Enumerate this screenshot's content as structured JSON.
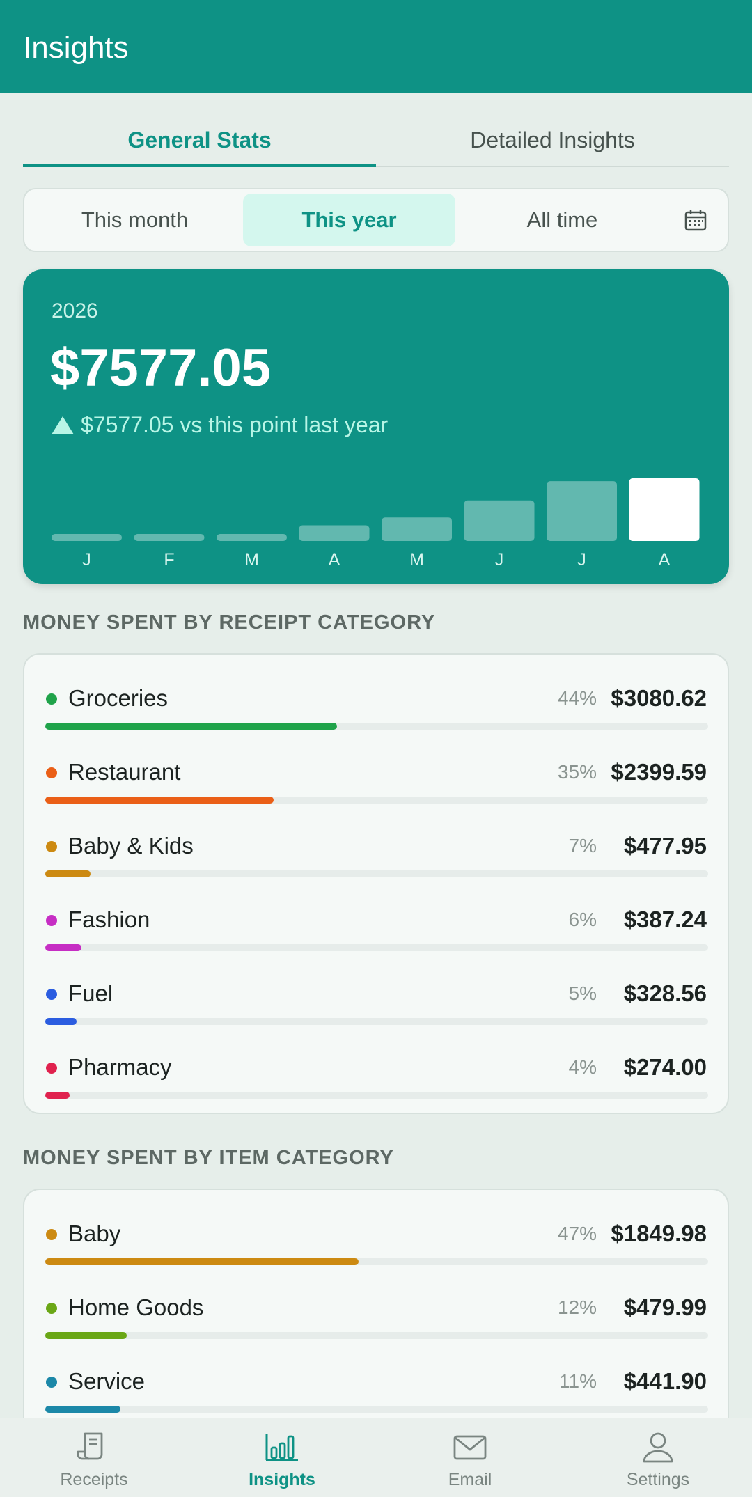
{
  "appbar": {
    "title": "Insights"
  },
  "tabs": [
    {
      "label": "General Stats",
      "active": true
    },
    {
      "label": "Detailed Insights",
      "active": false
    }
  ],
  "periods": [
    {
      "label": "This month",
      "active": false
    },
    {
      "label": "This year",
      "active": true
    },
    {
      "label": "All time",
      "active": false
    }
  ],
  "summary": {
    "year": "2026",
    "total": "$7577.05",
    "delta": "$7577.05 vs this point last year",
    "months": [
      "J",
      "F",
      "M",
      "A",
      "M",
      "J",
      "J",
      "A"
    ]
  },
  "chart_data": {
    "type": "bar",
    "categories": [
      "J",
      "F",
      "M",
      "A",
      "M",
      "J",
      "J",
      "A"
    ],
    "values": [
      80,
      60,
      80,
      220,
      330,
      570,
      840,
      880
    ],
    "highlight_index": 7,
    "ylim": [
      0,
      900
    ]
  },
  "receipt_categories": {
    "title": "MONEY SPENT BY RECEIPT CATEGORY",
    "items": [
      {
        "label": "Groceries",
        "pct": "44%",
        "amount": "$3080.62",
        "share": 0.44,
        "color": "#1fa34a"
      },
      {
        "label": "Restaurant",
        "pct": "35%",
        "amount": "$2399.59",
        "share": 0.345,
        "color": "#ea5f17"
      },
      {
        "label": "Baby & Kids",
        "pct": "7%",
        "amount": "$477.95",
        "share": 0.068,
        "color": "#cc8a12"
      },
      {
        "label": "Fashion",
        "pct": "6%",
        "amount": "$387.24",
        "share": 0.055,
        "color": "#c62ec4"
      },
      {
        "label": "Fuel",
        "pct": "5%",
        "amount": "$328.56",
        "share": 0.047,
        "color": "#2b5de0"
      },
      {
        "label": "Pharmacy",
        "pct": "4%",
        "amount": "$274.00",
        "share": 0.037,
        "color": "#e0224e"
      }
    ]
  },
  "item_categories": {
    "title": "MONEY SPENT BY ITEM CATEGORY",
    "items": [
      {
        "label": "Baby",
        "pct": "47%",
        "amount": "$1849.98",
        "share": 0.473,
        "color": "#cc8a12"
      },
      {
        "label": "Home Goods",
        "pct": "12%",
        "amount": "$479.99",
        "share": 0.123,
        "color": "#6aa716"
      },
      {
        "label": "Service",
        "pct": "11%",
        "amount": "$441.90",
        "share": 0.113,
        "color": "#1b88a8"
      }
    ]
  },
  "nav": [
    {
      "label": "Receipts",
      "icon": "receipt-icon",
      "active": false
    },
    {
      "label": "Insights",
      "icon": "bar-chart-icon",
      "active": true
    },
    {
      "label": "Email",
      "icon": "mail-icon",
      "active": false
    },
    {
      "label": "Settings",
      "icon": "person-icon",
      "active": false
    }
  ]
}
